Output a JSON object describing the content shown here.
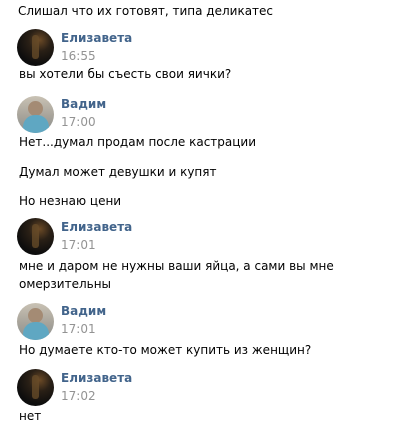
{
  "messages": {
    "m0": {
      "text": "Слишал что их готовят, типа деликатес"
    },
    "m1": {
      "author": "Елизавета",
      "time": "16:55",
      "lines": [
        "вы хотели бы съесть свои яички?"
      ]
    },
    "m2": {
      "author": "Вадим",
      "time": "17:00",
      "lines": [
        "Нет...думал продам после кастрации",
        "Думал может девушки и купят",
        "Но незнаю цени"
      ]
    },
    "m3": {
      "author": "Елизавета",
      "time": "17:01",
      "lines": [
        "мне и даром не нужны ваши яйца, а сами вы мне",
        "омерзительны"
      ]
    },
    "m4": {
      "author": "Вадим",
      "time": "17:01",
      "lines": [
        "Но думаете кто-то может купить из женщин?"
      ]
    },
    "m5": {
      "author": "Елизавета",
      "time": "17:02",
      "lines": [
        "нет"
      ]
    }
  }
}
